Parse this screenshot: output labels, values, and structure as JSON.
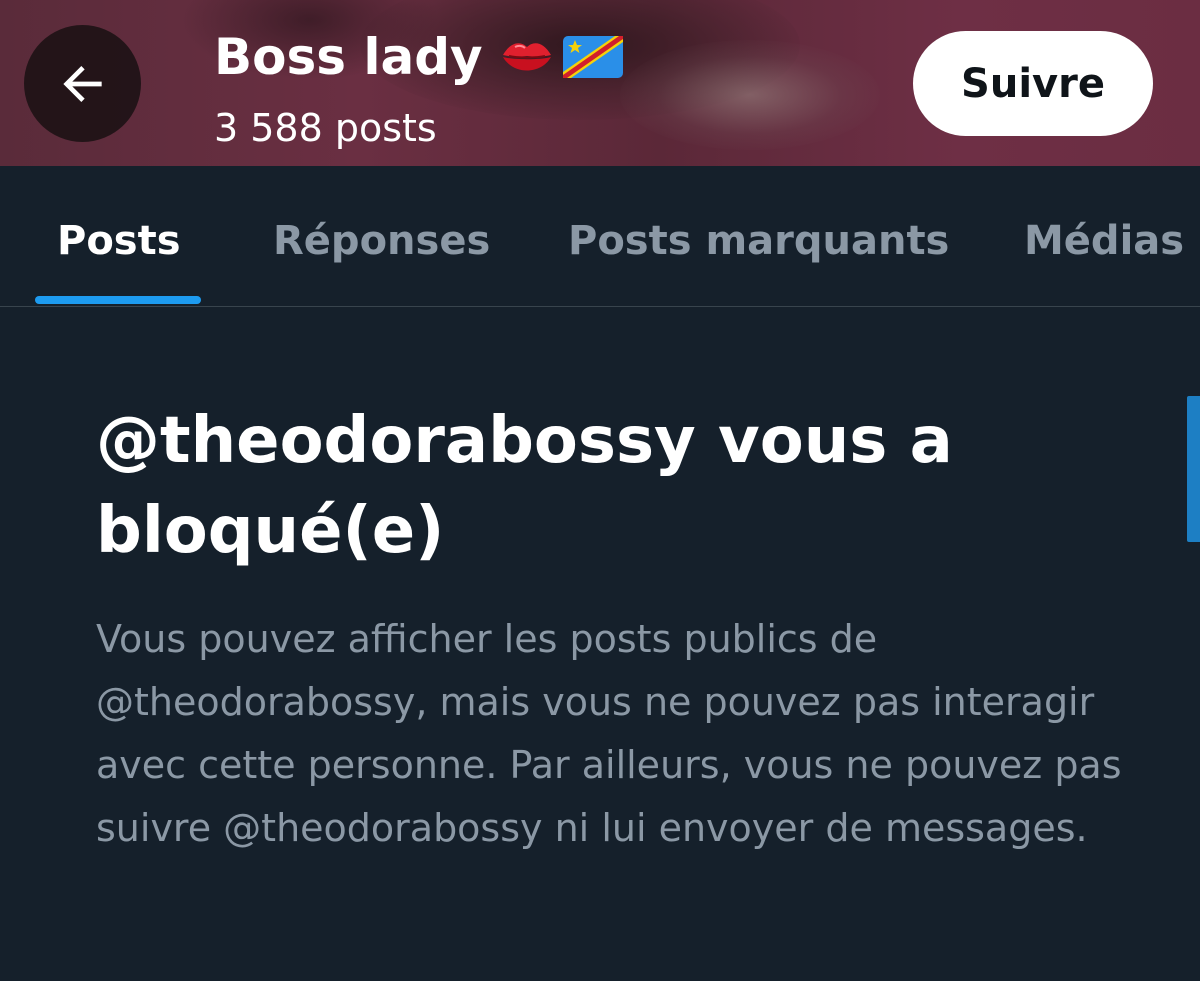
{
  "header": {
    "back_label": "Back",
    "display_name": "Boss lady",
    "name_emojis": [
      "lips-emoji",
      "flag-congo-drc-emoji"
    ],
    "post_count": "3 588 posts",
    "follow_label": "Suivre"
  },
  "tabs": [
    {
      "label": "Posts",
      "active": true
    },
    {
      "label": "Réponses",
      "active": false
    },
    {
      "label": "Posts marquants",
      "active": false
    },
    {
      "label": "Médias",
      "active": false
    }
  ],
  "blocked": {
    "title": "@theodorabossy vous a bloqué(e)",
    "description": "Vous pouvez afficher les posts publics de @theodorabossy, mais vous ne pouvez pas interagir avec cette personne. Par ailleurs, vous ne pouvez pas suivre @theodorabossy ni lui envoyer de messages."
  },
  "colors": {
    "background": "#15202b",
    "accent": "#1d9bf0",
    "secondary_text": "#8b98a5",
    "banner": "#6a2f42"
  }
}
